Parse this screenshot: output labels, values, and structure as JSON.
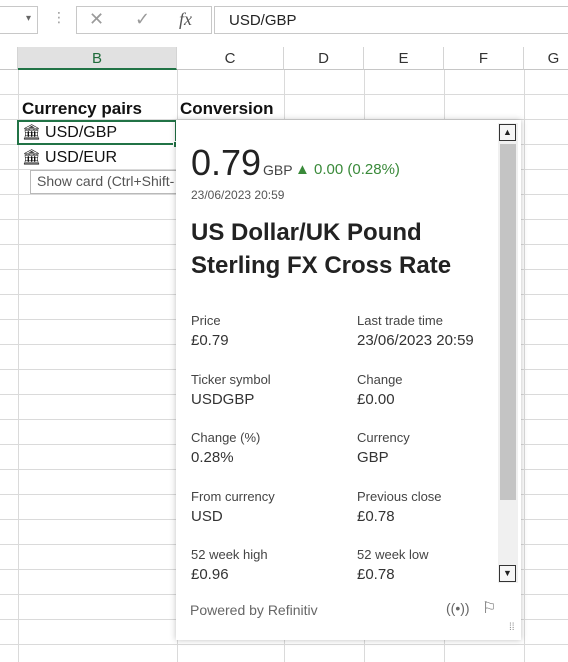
{
  "formula_bar": {
    "namebox_dropdown": "▾",
    "dots": "⋮",
    "cancel_icon": "✕",
    "enter_icon": "✓",
    "fx_label": "fx",
    "value": "USD/GBP"
  },
  "columns": [
    "B",
    "C",
    "D",
    "E",
    "F",
    "G"
  ],
  "cells": {
    "b_header": "Currency pairs",
    "c_header": "Conversion",
    "b_row1": "USD/GBP",
    "b_row2": "USD/EUR",
    "bank_icon": "🏛"
  },
  "tooltip": "Show card (Ctrl+Shift-",
  "card": {
    "price": "0.79",
    "currency": "GBP",
    "change": "▲ 0.00 (0.28%)",
    "timestamp": "23/06/2023 20:59",
    "title": "US Dollar/UK Pound Sterling FX Cross Rate",
    "fields": [
      {
        "label": "Price",
        "value": "£0.79"
      },
      {
        "label": "Last trade time",
        "value": "23/06/2023 20:59"
      },
      {
        "label": "Ticker symbol",
        "value": "USDGBP"
      },
      {
        "label": "Change",
        "value": "£0.00"
      },
      {
        "label": "Change (%)",
        "value": "0.28%"
      },
      {
        "label": "Currency",
        "value": "GBP"
      },
      {
        "label": "From currency",
        "value": "USD"
      },
      {
        "label": "Previous close",
        "value": "£0.78"
      },
      {
        "label": "52 week high",
        "value": "£0.96"
      },
      {
        "label": "52 week low",
        "value": "£0.78"
      }
    ],
    "powered_by": "Powered by Refinitiv",
    "radio_icon": "((•))",
    "flag_icon": "⚐",
    "grip_icon": "⁞⁞",
    "scroll_up": "▲",
    "scroll_down": "▼"
  },
  "colors": {
    "accent": "#217346",
    "positive": "#3a8a3a"
  }
}
